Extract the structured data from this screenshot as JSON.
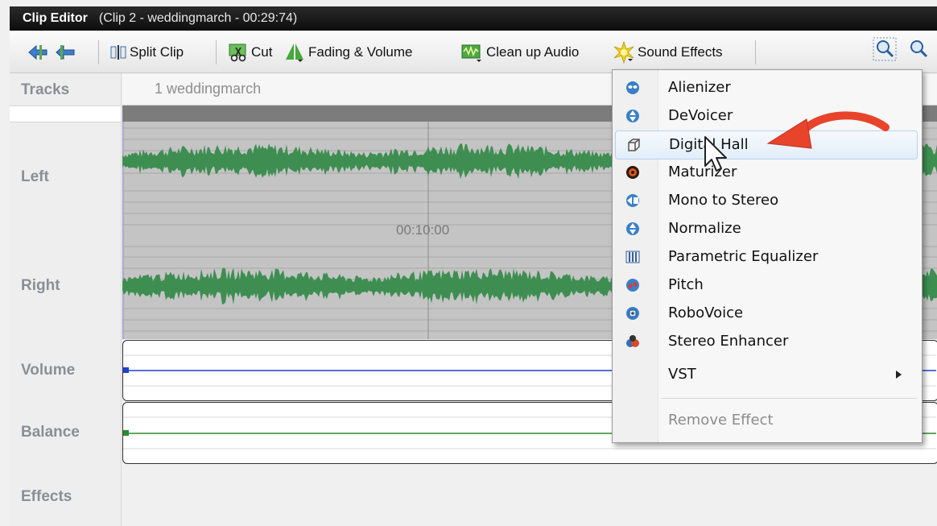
{
  "window": {
    "title": "Clip Editor",
    "subtitle": "(Clip 2 - weddingmarch - 00:29:74)"
  },
  "toolbar": {
    "split_clip": "Split Clip",
    "cut": "Cut",
    "fading_volume": "Fading & Volume",
    "clean_up_audio": "Clean up Audio",
    "sound_effects": "Sound Effects"
  },
  "sidebar": {
    "tracks": "Tracks",
    "left": "Left",
    "right": "Right",
    "volume": "Volume",
    "balance": "Balance",
    "effects": "Effects"
  },
  "track": {
    "name": "1 weddingmarch",
    "timecode": "00:10:00"
  },
  "colors": {
    "waveform": "#3e8e52",
    "volume_line": "#1f3fd6",
    "balance_line": "#2e8a2e",
    "highlight_arrow": "#e8442c"
  },
  "sound_effects_menu": {
    "items": [
      {
        "label": "Alienizer",
        "icon": "alien-icon"
      },
      {
        "label": "DeVoicer",
        "icon": "devoicer-icon"
      },
      {
        "label": "Digital Hall",
        "icon": "cube-icon"
      },
      {
        "label": "Maturizer",
        "icon": "maturizer-icon"
      },
      {
        "label": "Mono to Stereo",
        "icon": "mono-stereo-icon"
      },
      {
        "label": "Normalize",
        "icon": "normalize-icon"
      },
      {
        "label": "Parametric Equalizer",
        "icon": "equalizer-icon"
      },
      {
        "label": "Pitch",
        "icon": "pitch-icon"
      },
      {
        "label": "RoboVoice",
        "icon": "robot-icon"
      },
      {
        "label": "Stereo Enhancer",
        "icon": "stereo-enhancer-icon"
      },
      {
        "label": "VST",
        "icon": "submenu-arrow-icon"
      }
    ],
    "remove_effect": "Remove Effect"
  }
}
